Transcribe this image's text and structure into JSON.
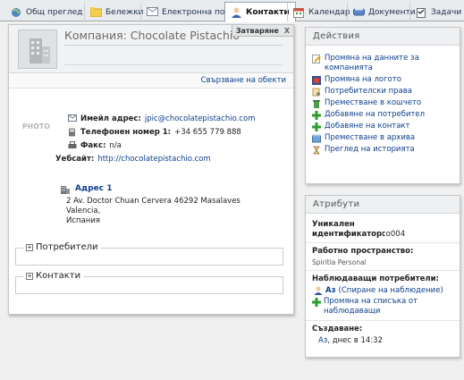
{
  "tabs": [
    {
      "label": "Общ преглед",
      "icon": "globe-icon"
    },
    {
      "label": "Бележки",
      "icon": "folder-icon"
    },
    {
      "label": "Електронна поща",
      "icon": "envelope-icon"
    },
    {
      "label": "Контакти",
      "icon": "contacts-icon",
      "active": true
    },
    {
      "label": "Календар",
      "icon": "calendar-icon"
    },
    {
      "label": "Документи",
      "icon": "documents-icon"
    },
    {
      "label": "Задачи",
      "icon": "tasks-icon"
    }
  ],
  "company": {
    "title": "Компания: Chocolate Pistachio",
    "close_label": "Затваряне",
    "close_x": "X",
    "link_objects": "Свързване на обекти",
    "photo_label": "PHOTO",
    "email_label": "Имейл адрес:",
    "email": "jpic@chocolatepistachio.com",
    "phone_label": "Телефонен номер 1:",
    "phone": "+34 655 779 888",
    "fax_label": "Факс:",
    "fax": "n/a",
    "website_label": "Уебсайт:",
    "website": "http://chocolatepistachio.com",
    "address_title": "Адрес 1",
    "address_line1": "2 Av. Doctor Chuan Cervera 46292 Masalaves",
    "address_line2": "Valencia,",
    "address_line3": "Испания",
    "section_users": "Потребители",
    "section_contacts": "Контакти"
  },
  "actions": {
    "title": "Действия",
    "items": [
      {
        "label": "Промяна на данните за компанията",
        "icon": "edit-icon"
      },
      {
        "label": "Промяна на логото",
        "icon": "logo-icon"
      },
      {
        "label": "Потребителски права",
        "icon": "permissions-icon"
      },
      {
        "label": "Преместване в кошчето",
        "icon": "trash-icon"
      },
      {
        "label": "Добавяне на потребител",
        "icon": "add-icon"
      },
      {
        "label": "Добавяне на контакт",
        "icon": "add-icon"
      },
      {
        "label": "Преместване в архива",
        "icon": "archive-icon"
      },
      {
        "label": "Преглед на историята",
        "icon": "history-icon"
      }
    ]
  },
  "attributes": {
    "title": "Атрибути",
    "unique_id_label": "Уникален идентификатор:",
    "unique_id": "co004",
    "workspace_label": "Работно пространство:",
    "workspace": "Spiritia Personal",
    "watchers_label": "Наблюдаващи потребители:",
    "watcher_me": "Аз",
    "watcher_stop": "(Спиране на наблюдение)",
    "watchers_change": "Промяна на списъка от наблюдаващи",
    "created_label": "Създаване:",
    "created_by": "Аз",
    "created_when": ", днес в 14:32"
  },
  "colors": {
    "link": "#0d3f8c",
    "add_green": "#2e9c2e",
    "panel_head": "#eef0f2"
  }
}
